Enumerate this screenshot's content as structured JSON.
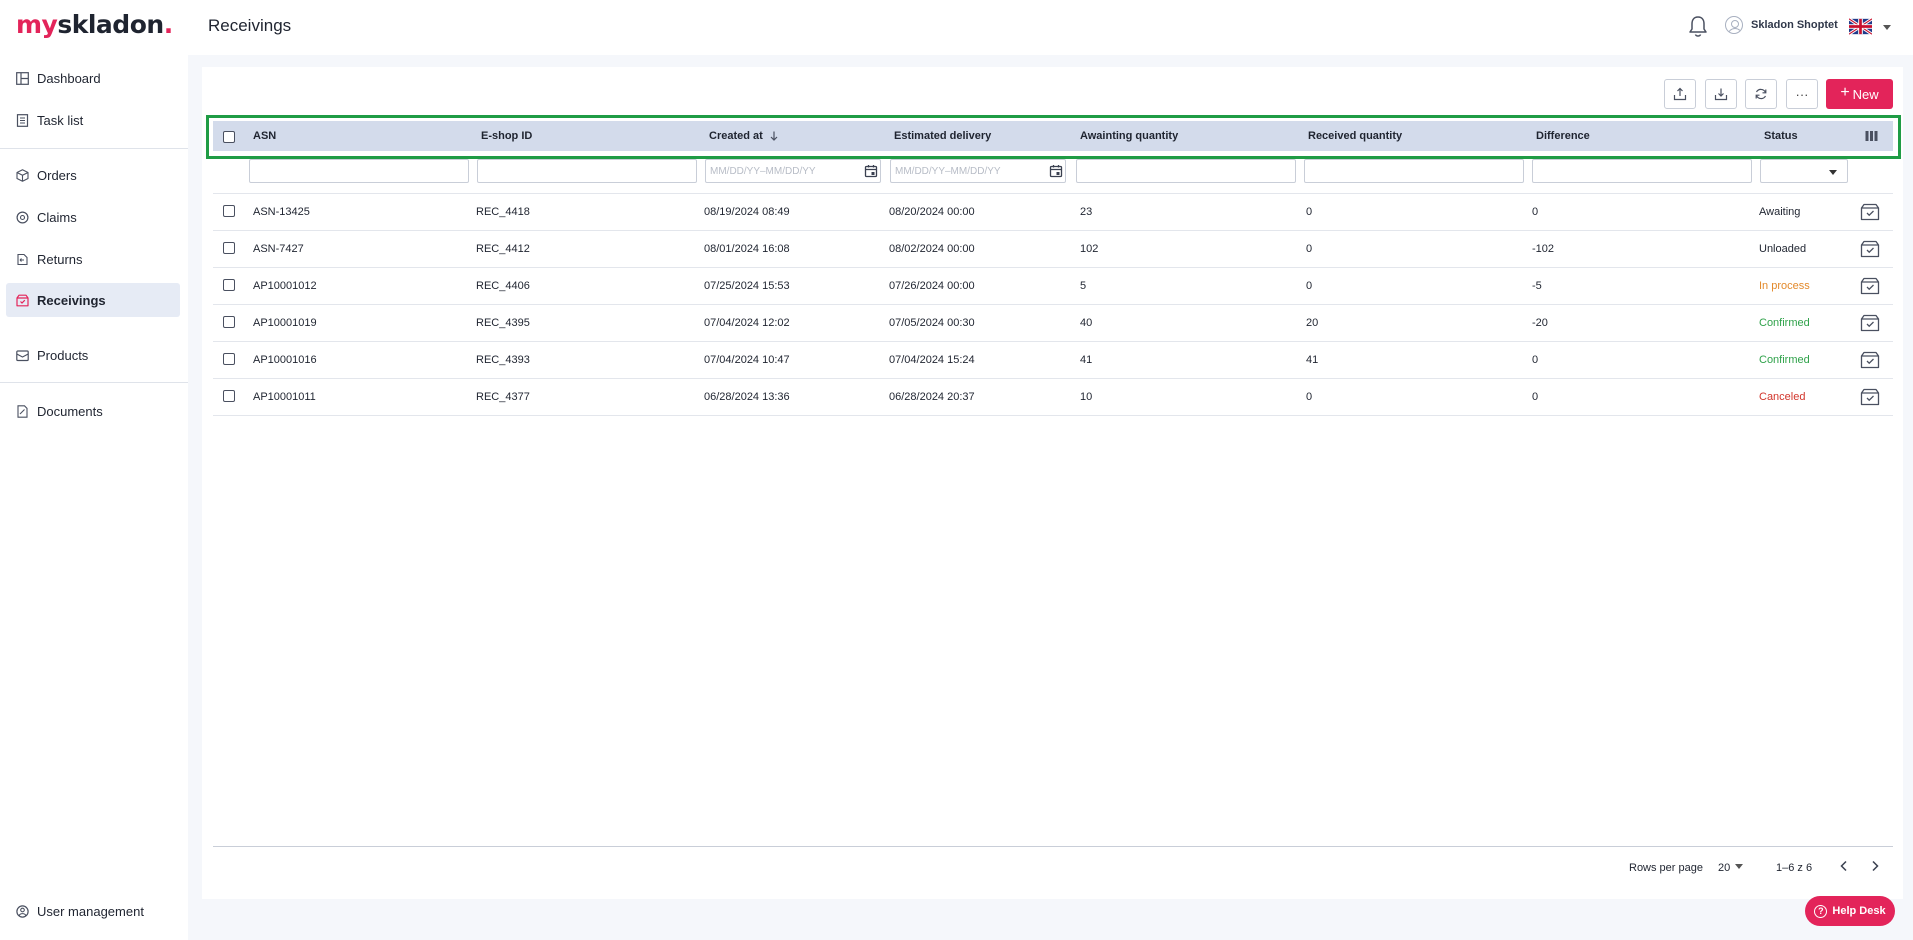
{
  "app": {
    "logo": {
      "my": "my",
      "skladon": "skladon",
      "dot": "."
    },
    "page_title": "Receivings",
    "user_name": "Skladon Shoptet",
    "language_flag": "flag-uk-icon"
  },
  "sidebar": {
    "items": [
      {
        "label": "Dashboard",
        "icon": "dashboard-icon"
      },
      {
        "label": "Task list",
        "icon": "task-list-icon"
      },
      {
        "label": "Orders",
        "icon": "orders-icon"
      },
      {
        "label": "Claims",
        "icon": "claims-icon"
      },
      {
        "label": "Returns",
        "icon": "returns-icon"
      },
      {
        "label": "Receivings",
        "icon": "receivings-icon",
        "active": true
      },
      {
        "label": "Products",
        "icon": "products-icon"
      },
      {
        "label": "Documents",
        "icon": "documents-icon"
      },
      {
        "label": "User management",
        "icon": "user-management-icon"
      }
    ]
  },
  "toolbar": {
    "export_icon": "export-icon",
    "import_icon": "import-icon",
    "refresh_icon": "refresh-icon",
    "more_label": "···",
    "new_label": "New"
  },
  "table": {
    "columns": [
      "ASN",
      "E-shop ID",
      "Created at",
      "Estimated delivery",
      "Awainting quantity",
      "Received quantity",
      "Difference",
      "Status"
    ],
    "sort_icon": "arrow-down-icon",
    "column_settings_icon": "columns-icon",
    "filters": {
      "created_at_placeholder": "MM/DD/YY–MM/DD/YY",
      "estimated_delivery_placeholder": "MM/DD/YY–MM/DD/YY"
    },
    "rows": [
      {
        "asn": "ASN-13425",
        "eshop": "REC_4418",
        "created": "08/19/2024 08:49",
        "estimated": "08/20/2024 00:00",
        "awaiting": "23",
        "received": "0",
        "difference": "0",
        "status": "Awaiting",
        "status_color": "#1f2430"
      },
      {
        "asn": "ASN-7427",
        "eshop": "REC_4412",
        "created": "08/01/2024 16:08",
        "estimated": "08/02/2024 00:00",
        "awaiting": "102",
        "received": "0",
        "difference": "-102",
        "status": "Unloaded",
        "status_color": "#1f2430"
      },
      {
        "asn": "AP10001012",
        "eshop": "REC_4406",
        "created": "07/25/2024 15:53",
        "estimated": "07/26/2024 00:00",
        "awaiting": "5",
        "received": "0",
        "difference": "-5",
        "status": "In process",
        "status_color": "#e38a2c"
      },
      {
        "asn": "AP10001019",
        "eshop": "REC_4395",
        "created": "07/04/2024 12:02",
        "estimated": "07/05/2024 00:30",
        "awaiting": "40",
        "received": "20",
        "difference": "-20",
        "status": "Confirmed",
        "status_color": "#2fa24a"
      },
      {
        "asn": "AP10001016",
        "eshop": "REC_4393",
        "created": "07/04/2024 10:47",
        "estimated": "07/04/2024 15:24",
        "awaiting": "41",
        "received": "41",
        "difference": "0",
        "status": "Confirmed",
        "status_color": "#2fa24a"
      },
      {
        "asn": "AP10001011",
        "eshop": "REC_4377",
        "created": "06/28/2024 13:36",
        "estimated": "06/28/2024 20:37",
        "awaiting": "10",
        "received": "0",
        "difference": "0",
        "status": "Canceled",
        "status_color": "#d2352b"
      }
    ]
  },
  "pagination": {
    "rows_per_page_label": "Rows per page",
    "rows_per_page_value": "20",
    "range_text": "1–6 z 6"
  },
  "help": {
    "label": "Help Desk"
  },
  "colors": {
    "accent": "#e3245a",
    "header_row": "#d3dbeb",
    "highlight": "#1f9c45"
  }
}
